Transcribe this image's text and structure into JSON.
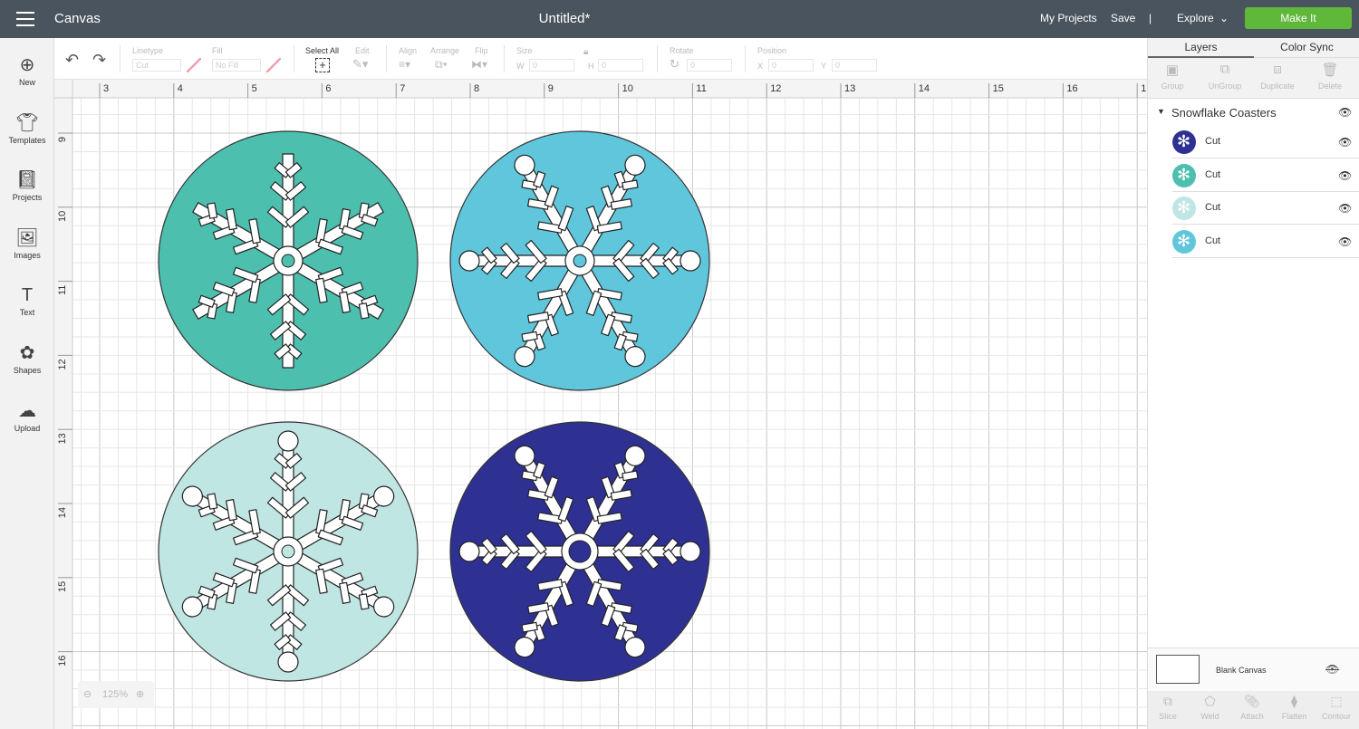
{
  "topbar": {
    "app": "Canvas",
    "title": "Untitled*",
    "my_projects": "My Projects",
    "save": "Save",
    "divider": "|",
    "explore": "Explore",
    "make_it": "Make It"
  },
  "sidebar": [
    {
      "label": "New",
      "icon": "plus-circle-icon"
    },
    {
      "label": "Templates",
      "icon": "shirt-icon"
    },
    {
      "label": "Projects",
      "icon": "notebook-icon"
    },
    {
      "label": "Images",
      "icon": "image-icon"
    },
    {
      "label": "Text",
      "icon": "text-icon"
    },
    {
      "label": "Shapes",
      "icon": "shapes-icon"
    },
    {
      "label": "Upload",
      "icon": "cloud-upload-icon"
    }
  ],
  "toolbar": {
    "linetype_label": "Linetype",
    "linetype_value": "Cut",
    "fill_label": "Fill",
    "fill_value": "No Fill",
    "select_all": "Select All",
    "edit": "Edit",
    "align": "Align",
    "arrange": "Arrange",
    "flip": "Flip",
    "size": "Size",
    "w_label": "W",
    "w_value": "0",
    "h_label": "H",
    "h_value": "0",
    "rotate": "Rotate",
    "rotate_value": "0",
    "position": "Position",
    "x_label": "X",
    "x_value": "0",
    "y_label": "Y",
    "y_value": "0"
  },
  "ruler": {
    "top": [
      "3",
      "4",
      "5",
      "6",
      "7",
      "8",
      "9",
      "10",
      "11",
      "12",
      "13",
      "14",
      "15",
      "16",
      "1"
    ],
    "left": [
      "9",
      "10",
      "11",
      "12",
      "13",
      "14",
      "15",
      "16"
    ]
  },
  "zoom": {
    "value": "125%"
  },
  "coasters": [
    {
      "color": "#4cbfae"
    },
    {
      "color": "#5fc6db"
    },
    {
      "color": "#bfe6e2"
    },
    {
      "color": "#2e3192"
    }
  ],
  "panel": {
    "tabs": [
      "Layers",
      "Color Sync"
    ],
    "tools": [
      "Group",
      "UnGroup",
      "Duplicate",
      "Delete"
    ],
    "group_name": "Snowflake Coasters",
    "layers": [
      {
        "label": "Cut",
        "color": "#2e3192"
      },
      {
        "label": "Cut",
        "color": "#4cbfae"
      },
      {
        "label": "Cut",
        "color": "#bfe6e2"
      },
      {
        "label": "Cut",
        "color": "#5fc6db"
      }
    ],
    "blank_canvas": "Blank Canvas",
    "bottom_tools": [
      "Slice",
      "Weld",
      "Attach",
      "Flatten",
      "Contour"
    ]
  },
  "colors": {
    "topbar": "#4a545e",
    "make_it": "#5fb83a"
  }
}
